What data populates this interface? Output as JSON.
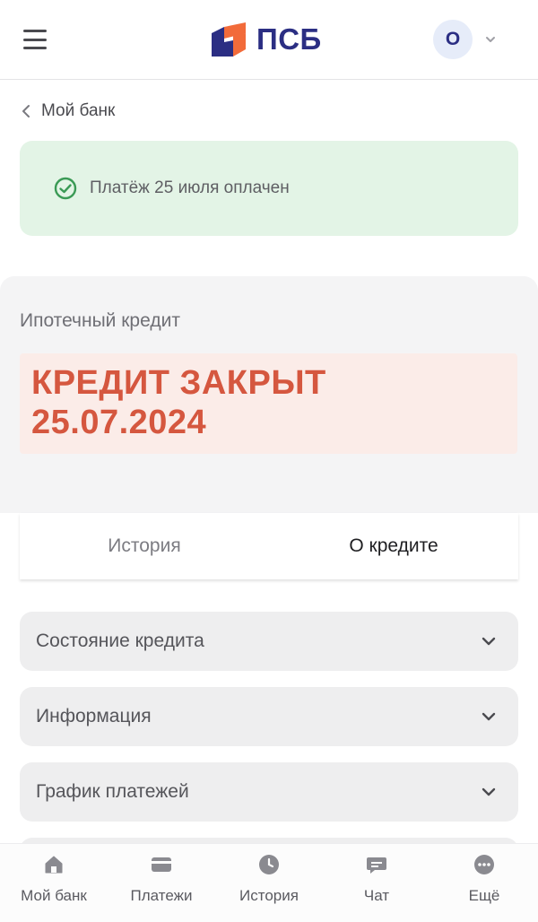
{
  "header": {
    "logo_text": "ПСБ",
    "avatar_letter": "О",
    "colors": {
      "brand_blue": "#2b2e83",
      "brand_orange": "#f26b3a"
    }
  },
  "breadcrumb": {
    "label": "Мой банк"
  },
  "notice": {
    "text": "Платёж 25 июля оплачен",
    "color": "#e3f4e6"
  },
  "loan": {
    "type": "Ипотечный кредит",
    "status_line1": "КРЕДИТ ЗАКРЫТ",
    "status_line2": "25.07.2024",
    "status_color": "#d5573f"
  },
  "tabs": [
    {
      "label": "История",
      "active": false
    },
    {
      "label": "О кредите",
      "active": true
    }
  ],
  "accordions": [
    {
      "title": "Состояние кредита"
    },
    {
      "title": "Информация"
    },
    {
      "title": "График платежей"
    }
  ],
  "bottom_nav": [
    {
      "label": "Мой банк",
      "icon": "home-icon"
    },
    {
      "label": "Платежи",
      "icon": "card-icon"
    },
    {
      "label": "История",
      "icon": "clock-icon"
    },
    {
      "label": "Чат",
      "icon": "chat-icon"
    },
    {
      "label": "Ещё",
      "icon": "more-icon"
    }
  ]
}
